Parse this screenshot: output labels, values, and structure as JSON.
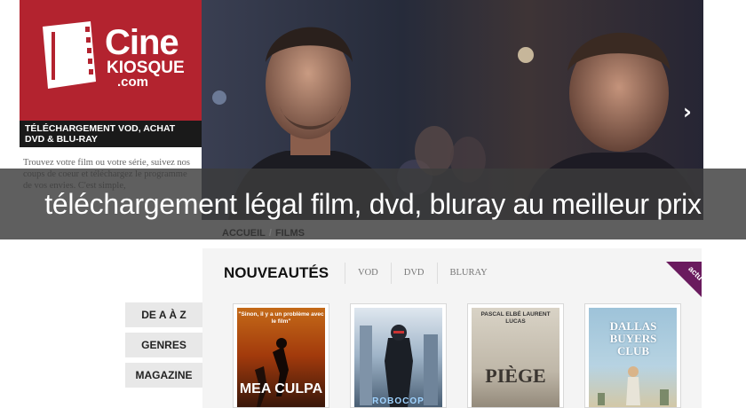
{
  "brand": {
    "name_line1": "Cine",
    "name_line2": "KIOSQUE",
    "name_line3": ".com",
    "accent_color": "#b3232f"
  },
  "tagline": {
    "line1": "Téléchargement VOD, achat",
    "line2": "DVD & Blu-ray"
  },
  "intro": {
    "text": "Trouvez votre film ou votre série, suivez nos coups de coeur et téléchargez le programme de vos envies. C'est simple,"
  },
  "hero": {
    "next_icon": "chevron-right-icon",
    "next_glyph": "›"
  },
  "overlay": {
    "caption": "téléchargement légal film, dvd, bluray au meilleur prix"
  },
  "breadcrumb": {
    "home": "Accueil",
    "separator": "/",
    "current": "Films"
  },
  "section": {
    "title": "Nouveautés",
    "tabs": [
      "VOD",
      "DVD",
      "BLURAY"
    ],
    "ribbon": "actu",
    "ribbon_color": "#6a1b5e"
  },
  "posters": [
    {
      "top": "\"Sinon, il y a un problème avec le film\"",
      "big": "MEA CULPA"
    },
    {
      "top": "",
      "big": "ROBOCOP"
    },
    {
      "top": "PASCAL ELBÉ   LAURENT LUCAS",
      "big": "PIÈGE"
    },
    {
      "top": "",
      "big": "DALLAS BUYERS CLUB"
    }
  ],
  "nav": {
    "items": [
      "De A à Z",
      "Genres",
      "Magazine"
    ]
  }
}
